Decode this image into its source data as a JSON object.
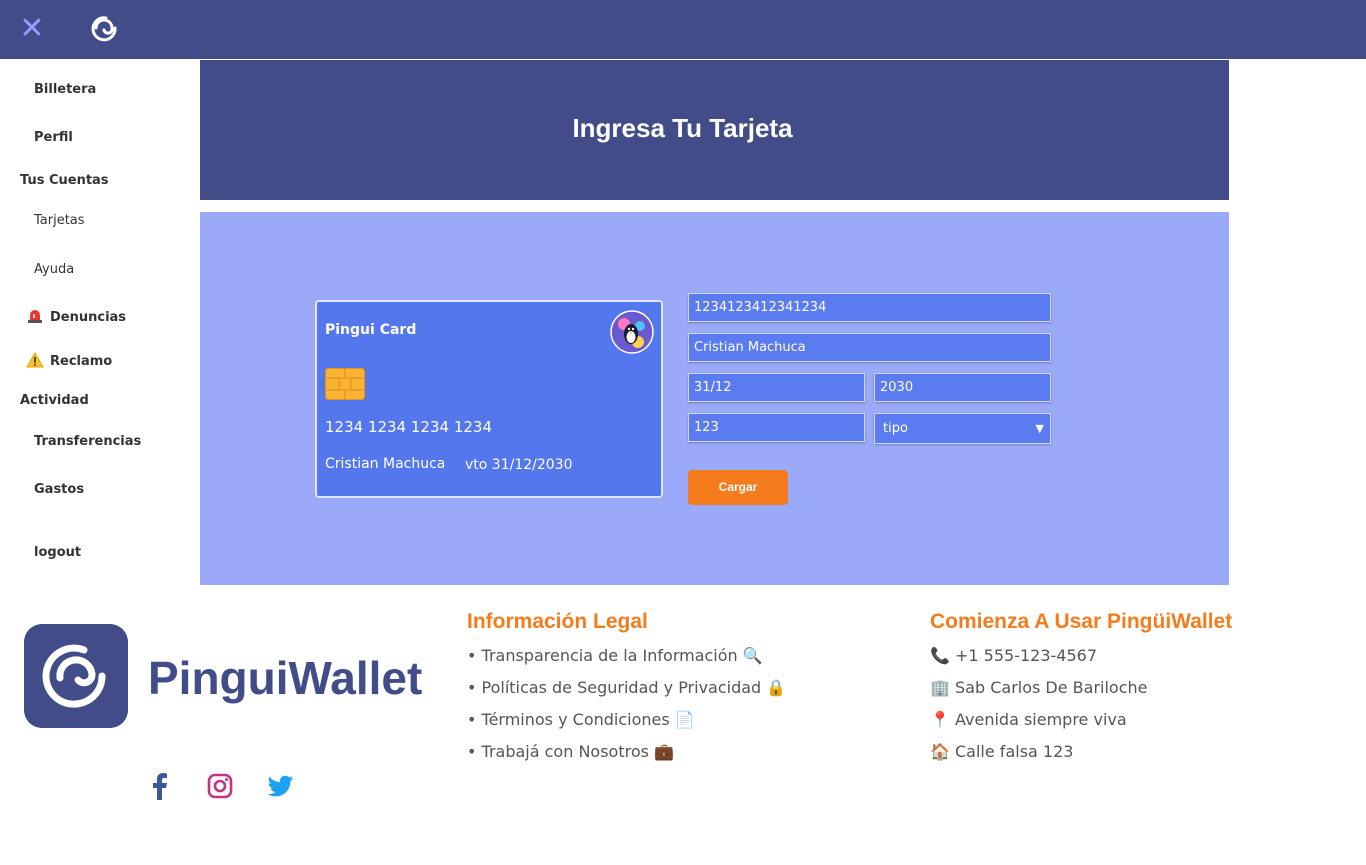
{
  "topbar": {
    "close_glyph": "✕",
    "logo_icon": "pingui-logo-icon"
  },
  "sidebar": {
    "items": [
      {
        "label": "Billetera"
      },
      {
        "label": "Perfil"
      },
      {
        "label": "Tarjetas"
      },
      {
        "label": "Ayuda"
      },
      {
        "label": "Denuncias",
        "icon": "siren-icon"
      },
      {
        "label": "Reclamo",
        "icon": "warning-icon"
      },
      {
        "label": "Transferencias"
      },
      {
        "label": "Gastos"
      },
      {
        "label": "logout"
      }
    ],
    "sections": {
      "cuentas": "Tus Cuentas",
      "actividad": "Actividad"
    }
  },
  "header": {
    "title": "Ingresa Tu Tarjeta"
  },
  "card": {
    "title": "Pingui Card",
    "number": "1234 1234 1234 1234",
    "holder": "Cristian Machuca",
    "expiry": "vto 31/12/2030"
  },
  "form": {
    "number_value": "1234123412341234",
    "name_value": "Cristian Machuca",
    "date_value": "31/12",
    "year_value": "2030",
    "cvv_value": "123",
    "type_selected": "tipo",
    "submit_label": "Cargar"
  },
  "footer": {
    "brand": "PinguiWallet",
    "legal": {
      "title": "Información Legal",
      "items": [
        "• Transparencia de la Información 🔍",
        "• Políticas de Seguridad y Privacidad 🔒",
        "• Términos y Condiciones 📄",
        "• Trabajá con Nosotros 💼"
      ]
    },
    "start": {
      "title": "Comienza A Usar PingüiWallet",
      "items": [
        "📞 +1 555-123-4567",
        "🏢 Sab Carlos De Bariloche",
        "📍 Avenida siempre viva",
        "🏠 Calle falsa 123"
      ]
    },
    "social": [
      "facebook-icon",
      "instagram-icon",
      "twitter-icon"
    ]
  },
  "colors": {
    "primary": "#414c89",
    "panel": "#9aaaf8",
    "card": "#5577ee",
    "accent": "#f47c1c"
  }
}
